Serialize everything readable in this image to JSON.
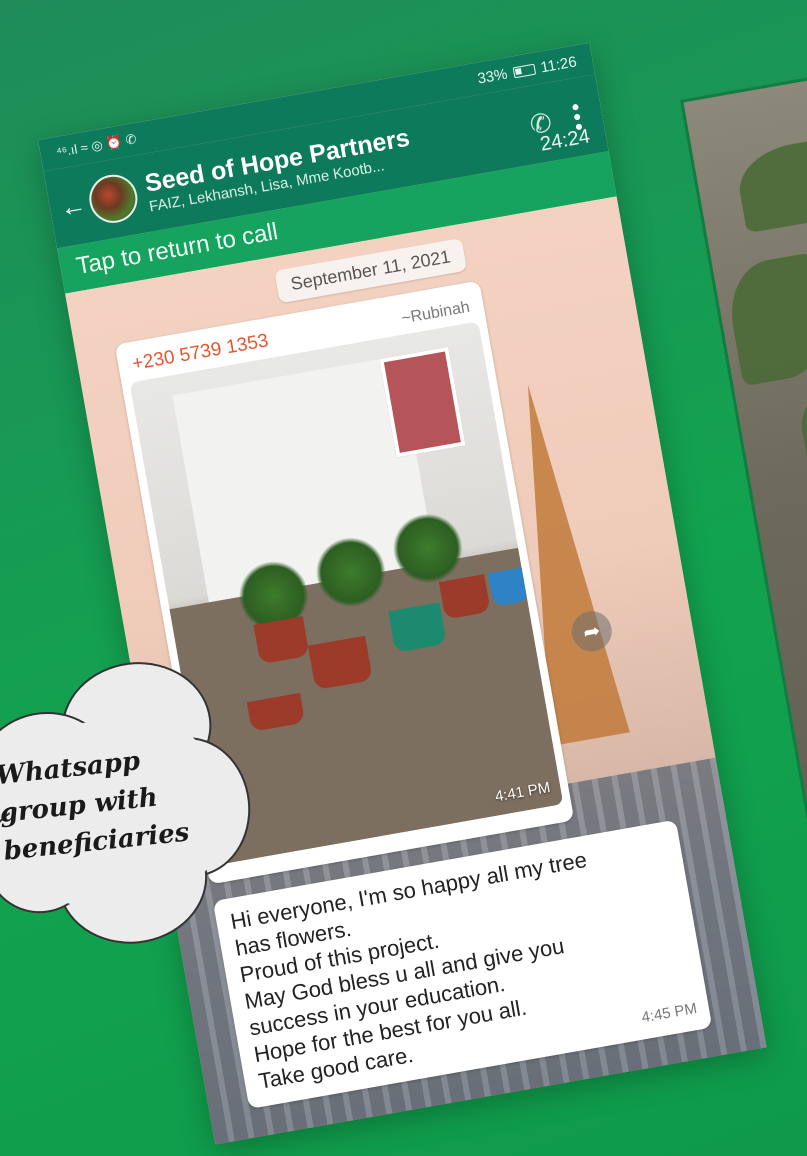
{
  "status_bar": {
    "left_icons": "⁴⁶.ıl ≈ ◎ ⏰ ✆",
    "battery": "33%",
    "time": "11:26"
  },
  "chat_header": {
    "group_name": "Seed of Hope Partners",
    "members": "FAIZ, Lekhansh, Lisa, Mme Kootb...",
    "call_timer": "24:24"
  },
  "return_to_call": "Tap to return to call",
  "date_chip": "September 11, 2021",
  "image_message": {
    "sender_phone": "+230 5739 1353",
    "sender_name": "~Rubinah",
    "time": "4:41 PM"
  },
  "text_message": {
    "lines": [
      "Hi everyone, I'm so happy  all my tree",
      "has  flowers.",
      "Proud of this project.",
      "May God bless u all and give you",
      "success in your education.",
      "Hope for the best for you all.",
      "Take good care."
    ],
    "time": "4:45 PM"
  },
  "callout": {
    "lines": [
      "Whatsapp",
      "group with",
      "beneficiaries"
    ]
  },
  "icons": {
    "back": "arrow-left-icon",
    "call_add": "phone-plus-icon",
    "menu": "more-vertical-icon",
    "forward": "forward-icon",
    "chevron": "chevron-down-icon"
  },
  "colors": {
    "background": "#12a34f",
    "header": "#0e7a5c",
    "return_bar": "#16a35f",
    "sender_phone": "#e4572e"
  }
}
